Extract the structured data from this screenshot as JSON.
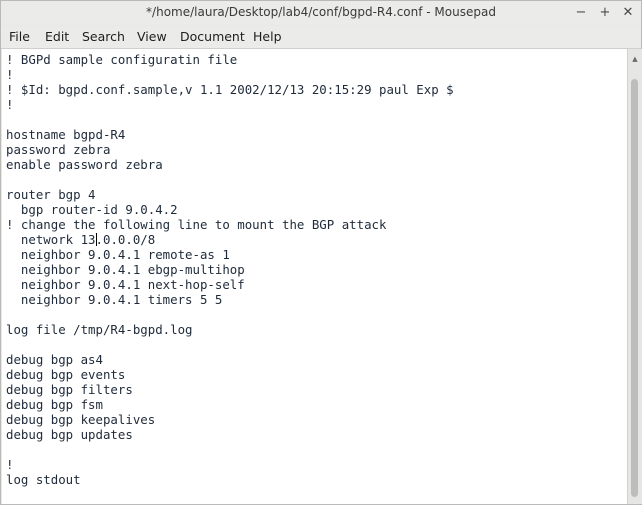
{
  "window": {
    "title": "*/home/laura/Desktop/lab4/conf/bgpd-R4.conf - Mousepad",
    "minimize_icon": "minimize-icon",
    "maximize_icon": "maximize-icon",
    "close_icon": "close-icon",
    "minimize_glyph": "−",
    "maximize_glyph": "+",
    "close_glyph": "✕"
  },
  "menubar": {
    "items": [
      "File",
      "Edit",
      "Search",
      "View",
      "Document",
      "Help"
    ]
  },
  "editor": {
    "lines": [
      "! BGPd sample configuratin file",
      "!",
      "! $Id: bgpd.conf.sample,v 1.1 2002/12/13 20:15:29 paul Exp $",
      "!",
      "",
      "hostname bgpd-R4",
      "password zebra",
      "enable password zebra",
      "",
      "router bgp 4",
      "  bgp router-id 9.0.4.2",
      "! change the following line to mount the BGP attack",
      "  network 13.0.0.0/8",
      "  neighbor 9.0.4.1 remote-as 1",
      "  neighbor 9.0.4.1 ebgp-multihop",
      "  neighbor 9.0.4.1 next-hop-self",
      "  neighbor 9.0.4.1 timers 5 5",
      "",
      "log file /tmp/R4-bgpd.log",
      "",
      "debug bgp as4",
      "debug bgp events",
      "debug bgp filters",
      "debug bgp fsm",
      "debug bgp keepalives",
      "debug bgp updates",
      "",
      "!",
      "log stdout"
    ],
    "caret": {
      "line": 13,
      "column": 12
    }
  },
  "scrollbar": {
    "up_arrow_glyph": "▲"
  }
}
